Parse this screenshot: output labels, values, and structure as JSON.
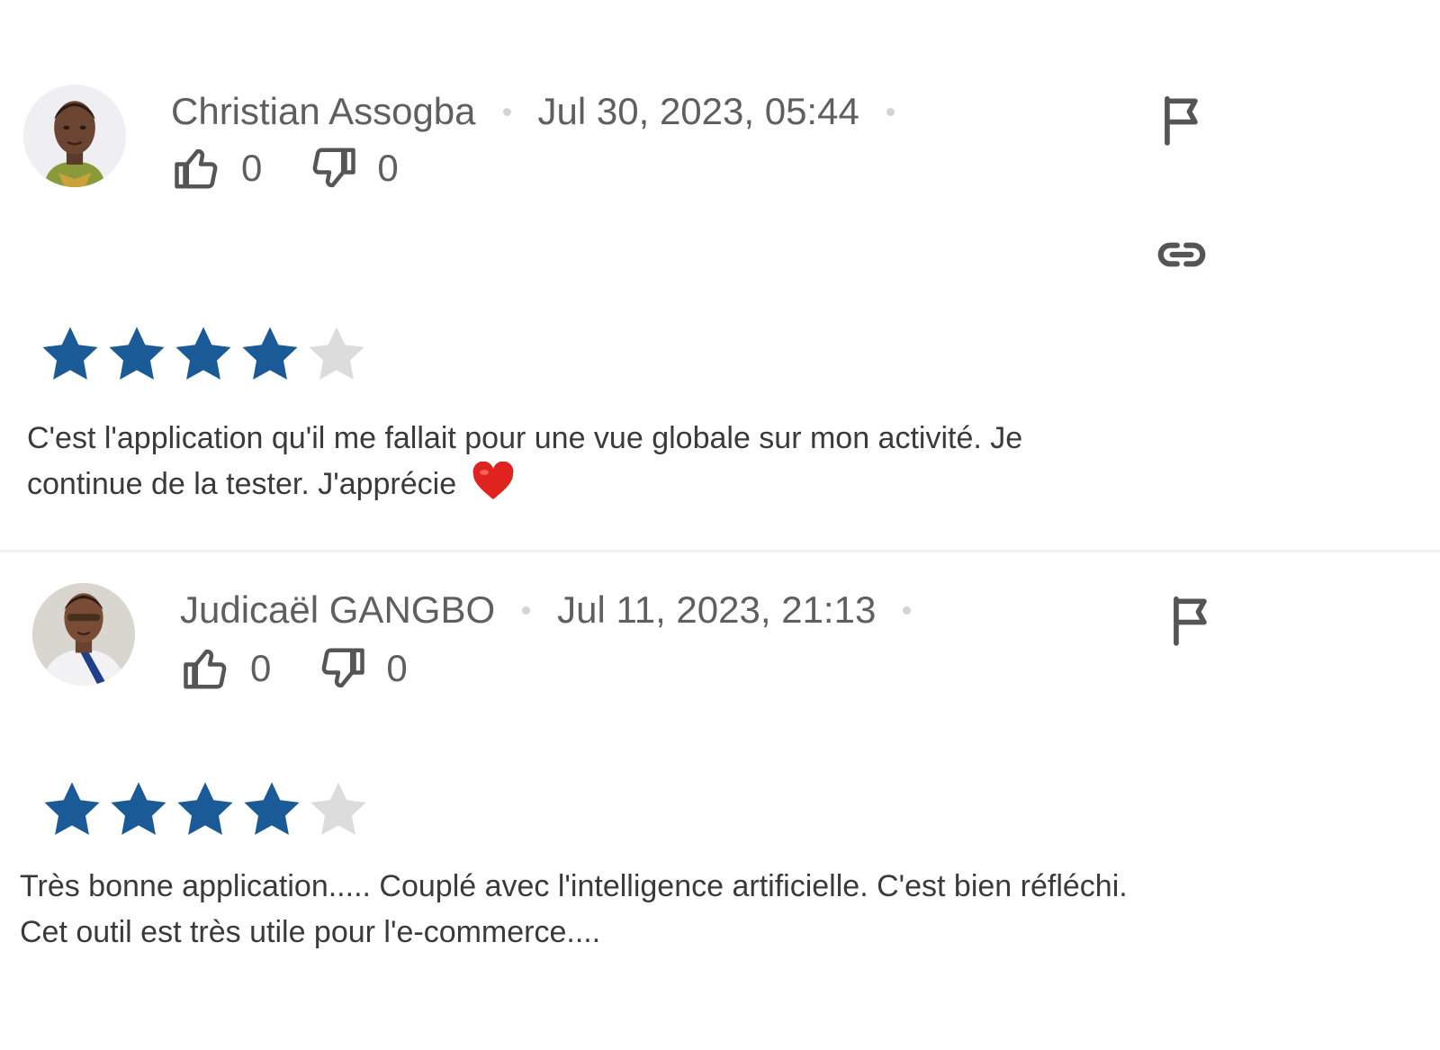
{
  "colors": {
    "star_filled": "#1a5a96",
    "star_empty": "#dcdcdc",
    "icon": "#555555",
    "meta_text": "#5f5f5f",
    "body_text": "#3a3a3a"
  },
  "reviews": [
    {
      "author": "Christian Assogba",
      "date": "Jul 30, 2023, 05:44",
      "likes": "0",
      "dislikes": "0",
      "rating": 4,
      "rating_max": 5,
      "text": "C'est l'application qu'il me fallait pour une vue globale sur mon activité. Je continue de la tester. J'apprécie",
      "emoji": "heart-emoji",
      "icons": [
        "thumbs-up-icon",
        "thumbs-down-icon",
        "flag-icon",
        "link-icon"
      ]
    },
    {
      "author": "Judicaël GANGBO",
      "date": "Jul 11, 2023, 21:13",
      "likes": "0",
      "dislikes": "0",
      "rating": 4,
      "rating_max": 5,
      "text": "Très bonne application..... Couplé avec l'intelligence artificielle. C'est bien réfléchi. Cet outil est très utile pour l'e-commerce....",
      "icons": [
        "thumbs-up-icon",
        "thumbs-down-icon",
        "flag-icon"
      ]
    }
  ]
}
